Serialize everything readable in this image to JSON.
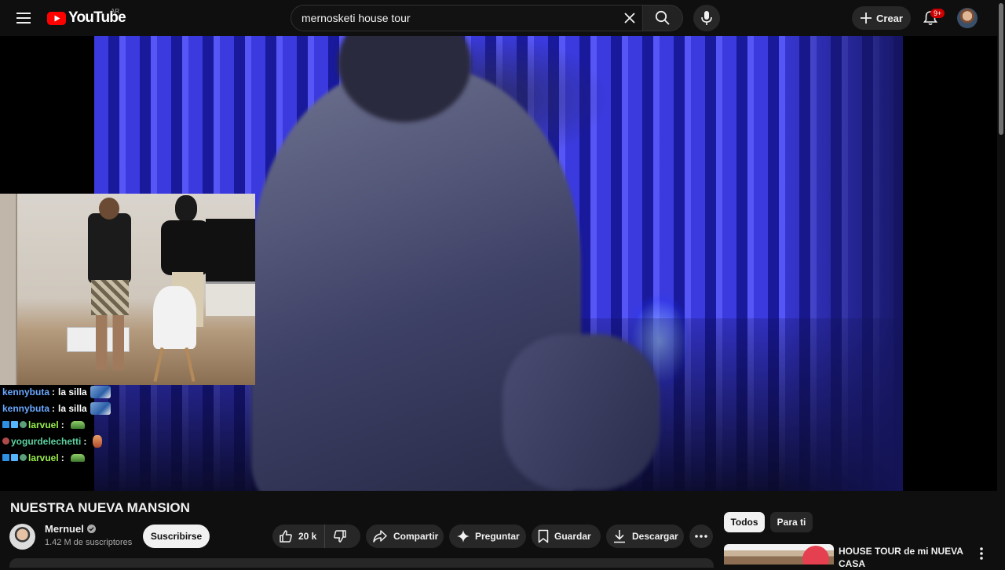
{
  "masthead": {
    "logo_text": "YouTube",
    "country_code": "AR",
    "search_value": "mernosketi house tour",
    "create_label": "Crear",
    "notifications_badge": "9+"
  },
  "chat": [
    {
      "user": "kennybuta",
      "user_color": "#6aa8ff",
      "message": "la silla",
      "badges": [],
      "emote": "emote-chair"
    },
    {
      "user": "kennybuta",
      "user_color": "#6aa8ff",
      "message": "la silla",
      "badges": [],
      "emote": "emote-chair"
    },
    {
      "user": "larvuel",
      "user_color": "#9aef4f",
      "message": "",
      "badges": [
        "b1",
        "b2",
        "b3"
      ],
      "emote": "emote-car"
    },
    {
      "user": "yogurdelechetti",
      "user_color": "#5ed1a0",
      "message": "",
      "badges": [
        "b4"
      ],
      "emote": "emote-face"
    },
    {
      "user": "larvuel",
      "user_color": "#9aef4f",
      "message": "",
      "badges": [
        "b1",
        "b2",
        "b3"
      ],
      "emote": "emote-car"
    }
  ],
  "video": {
    "title": "NUESTRA NUEVA MANSION",
    "channel_name": "Mernuel",
    "subscribers": "1.42 M de suscriptores",
    "subscribe_label": "Suscribirse",
    "likes": "20 k",
    "share_label": "Compartir",
    "ask_label": "Preguntar",
    "save_label": "Guardar",
    "download_label": "Descargar"
  },
  "sidebar": {
    "chips": [
      "Todos",
      "Para ti"
    ],
    "recommendation_title": "HOUSE TOUR de mi NUEVA CASA"
  },
  "colors": {
    "background": "#0f0f0f",
    "brand_red": "#ff0000",
    "pill_bg": "#272727",
    "badge_red": "#cc0000"
  }
}
